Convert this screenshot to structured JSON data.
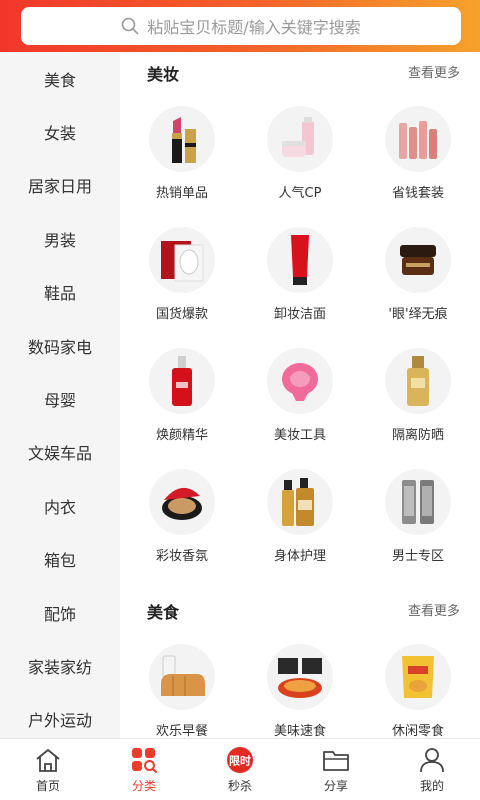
{
  "search": {
    "placeholder": "粘贴宝贝标题/输入关键字搜索"
  },
  "sidebar": {
    "items": [
      {
        "label": "美食"
      },
      {
        "label": "女装"
      },
      {
        "label": "居家日用"
      },
      {
        "label": "男装"
      },
      {
        "label": "鞋品"
      },
      {
        "label": "数码家电"
      },
      {
        "label": "母婴"
      },
      {
        "label": "文娱车品"
      },
      {
        "label": "内衣"
      },
      {
        "label": "箱包"
      },
      {
        "label": "配饰"
      },
      {
        "label": "家装家纺"
      },
      {
        "label": "户外运动"
      }
    ]
  },
  "sections": [
    {
      "title": "美妆",
      "more": "查看更多",
      "items": [
        {
          "label": "热销单品",
          "icon": "lipstick-icon"
        },
        {
          "label": "人气CP",
          "icon": "skincare-set-icon"
        },
        {
          "label": "省钱套装",
          "icon": "bottle-set-icon"
        },
        {
          "label": "国货爆款",
          "icon": "face-mask-icon"
        },
        {
          "label": "卸妆洁面",
          "icon": "cleanser-tube-icon"
        },
        {
          "label": "'眼'绎无痕",
          "icon": "eye-cream-jar-icon"
        },
        {
          "label": "焕颜精华",
          "icon": "serum-bottle-icon"
        },
        {
          "label": "美妆工具",
          "icon": "cleansing-brush-icon"
        },
        {
          "label": "隔离防晒",
          "icon": "sunscreen-icon"
        },
        {
          "label": "彩妆香氛",
          "icon": "cushion-compact-icon"
        },
        {
          "label": "身体护理",
          "icon": "body-lotion-icon"
        },
        {
          "label": "男士专区",
          "icon": "mens-care-icon"
        }
      ]
    },
    {
      "title": "美食",
      "more": "查看更多",
      "items": [
        {
          "label": "欢乐早餐",
          "icon": "bread-milk-icon"
        },
        {
          "label": "美味速食",
          "icon": "instant-noodles-icon"
        },
        {
          "label": "休闲零食",
          "icon": "chips-bag-icon"
        }
      ]
    }
  ],
  "bottom_nav": [
    {
      "label": "首页",
      "icon": "home-icon"
    },
    {
      "label": "分类",
      "icon": "category-icon",
      "active": true
    },
    {
      "label": "秒杀",
      "icon": "flash-sale-icon",
      "badge": "限时"
    },
    {
      "label": "分享",
      "icon": "folder-share-icon"
    },
    {
      "label": "我的",
      "icon": "profile-icon"
    }
  ],
  "colors": {
    "accent": "#f03a2c",
    "header_start": "#f2362a",
    "header_end": "#f5a22c"
  }
}
